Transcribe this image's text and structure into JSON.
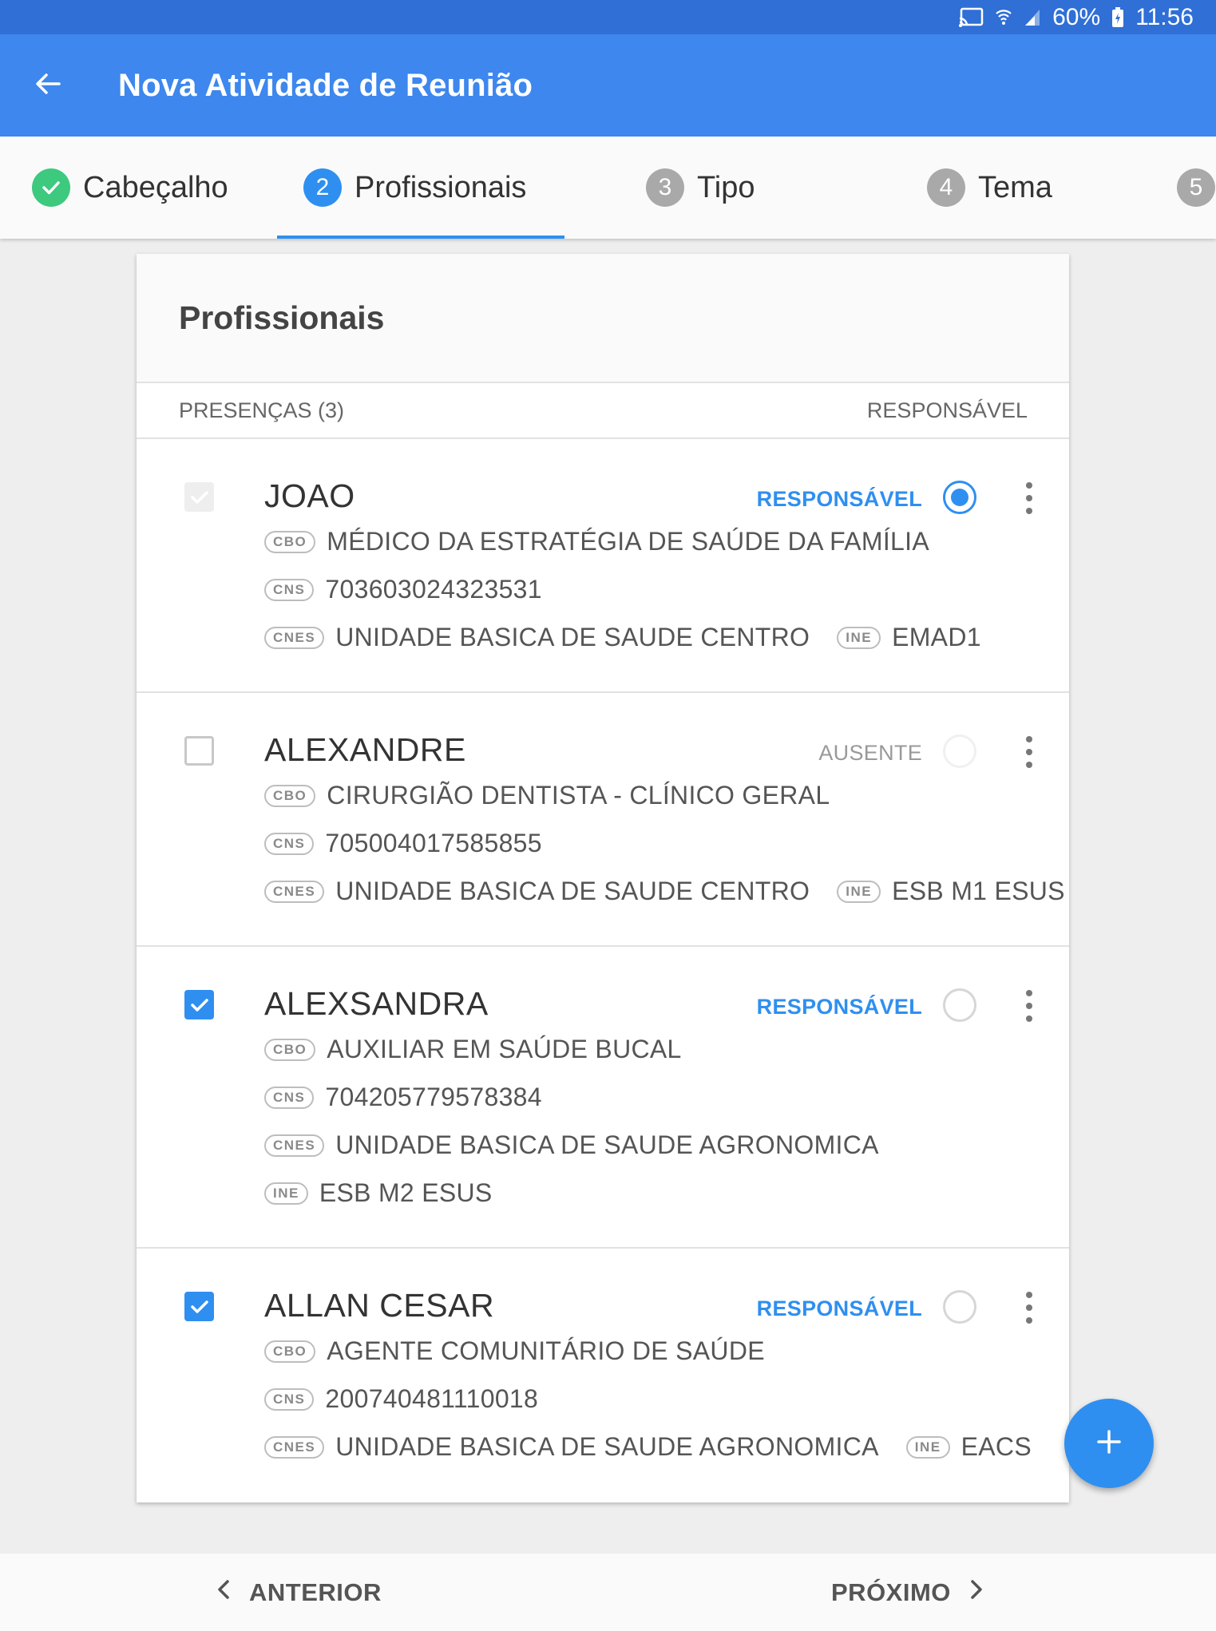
{
  "status_bar": {
    "battery": "60%",
    "time": "11:56",
    "icons": [
      "cast-icon",
      "wifi-icon",
      "signal-icon",
      "battery-icon"
    ]
  },
  "app_bar": {
    "title": "Nova Atividade de Reunião",
    "back_icon": "arrow-left-icon"
  },
  "stepper": {
    "steps": [
      {
        "number": "✓",
        "label": "Cabeçalho",
        "state": "done"
      },
      {
        "number": "2",
        "label": "Profissionais",
        "state": "active"
      },
      {
        "number": "3",
        "label": "Tipo",
        "state": "pending"
      },
      {
        "number": "4",
        "label": "Tema",
        "state": "pending"
      },
      {
        "number": "5",
        "label": "",
        "state": "pending"
      }
    ]
  },
  "card": {
    "title": "Profissionais",
    "presences_label": "PRESENÇAS (3)",
    "responsible_header": "RESPONSÁVEL"
  },
  "professionals": [
    {
      "name": "JOAO",
      "checked": "disabled",
      "tag": "RESPONSÁVEL",
      "radio": "selected",
      "cbo_badge": "CBO",
      "cbo": "MÉDICO DA ESTRATÉGIA DE SAÚDE DA FAMÍLIA",
      "cns_badge": "CNS",
      "cns": "703603024323531",
      "cnes_badge": "CNES",
      "cnes": "UNIDADE BASICA DE SAUDE CENTRO",
      "ine_badge": "INE",
      "ine": "EMAD1"
    },
    {
      "name": "ALEXANDRE",
      "checked": "unchecked",
      "tag": "AUSENTE",
      "radio": "disabled",
      "cbo_badge": "CBO",
      "cbo": "CIRURGIÃO DENTISTA - CLÍNICO GERAL",
      "cns_badge": "CNS",
      "cns": "705004017585855",
      "cnes_badge": "CNES",
      "cnes": "UNIDADE BASICA DE SAUDE CENTRO",
      "ine_badge": "INE",
      "ine": "ESB M1 ESUS"
    },
    {
      "name": "ALEXSANDRA",
      "checked": "checked",
      "tag": "RESPONSÁVEL",
      "radio": "unselected",
      "cbo_badge": "CBO",
      "cbo": "AUXILIAR EM SAÚDE BUCAL",
      "cns_badge": "CNS",
      "cns": "704205779578384",
      "cnes_badge": "CNES",
      "cnes": "UNIDADE BASICA DE SAUDE AGRONOMICA",
      "ine_badge": "INE",
      "ine": "ESB M2 ESUS"
    },
    {
      "name": "ALLAN CESAR",
      "checked": "checked",
      "tag": "RESPONSÁVEL",
      "radio": "unselected",
      "cbo_badge": "CBO",
      "cbo": "AGENTE COMUNITÁRIO DE SAÚDE",
      "cns_badge": "CNS",
      "cns": "200740481110018",
      "cnes_badge": "CNES",
      "cnes": "UNIDADE BASICA DE SAUDE AGRONOMICA",
      "ine_badge": "INE",
      "ine": "EACS"
    }
  ],
  "fab": {
    "icon": "plus-icon"
  },
  "bottom_nav": {
    "previous": "ANTERIOR",
    "next": "PRÓXIMO"
  },
  "colors": {
    "primary": "#3d87ee",
    "status_bar": "#2f6fd6",
    "accent": "#2f8ff0",
    "done": "#3dc97e"
  }
}
